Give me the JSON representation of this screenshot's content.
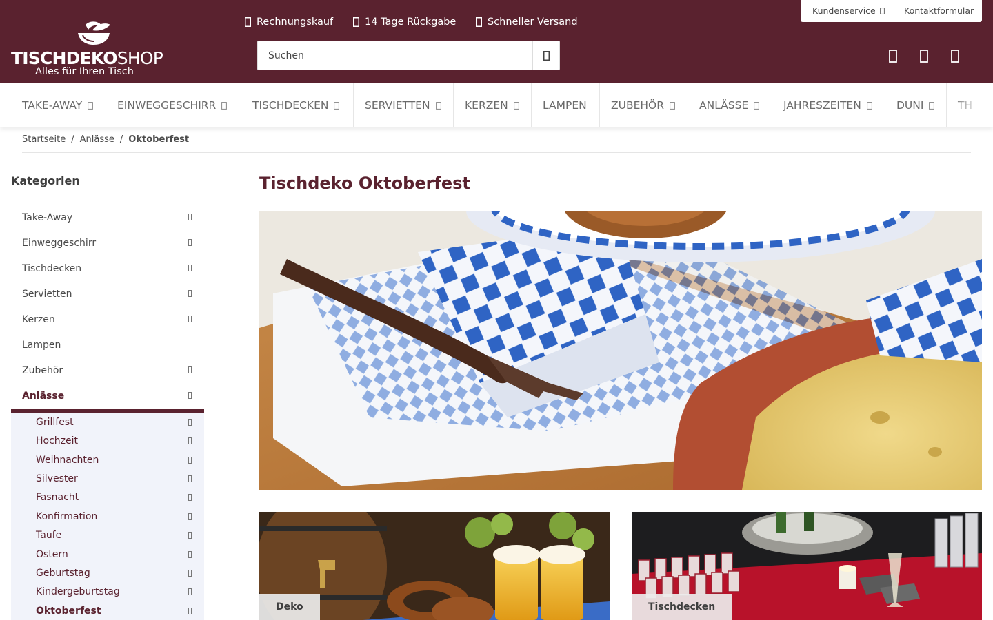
{
  "brand": {
    "name_bold": "TISCHDEKO",
    "name_light": "SHOP",
    "tagline": "Alles für Ihren Tisch",
    "header_color": "#5a222f"
  },
  "usps": [
    {
      "icon": "invoice-icon",
      "label": "Rechnungskauf"
    },
    {
      "icon": "return-icon",
      "label": "14 Tage Rückgabe"
    },
    {
      "icon": "truck-icon",
      "label": "Schneller Versand"
    }
  ],
  "service": {
    "customer_service": "Kundenservice",
    "contact_form": "Kontaktformular"
  },
  "search": {
    "placeholder": "Suchen"
  },
  "header_icons": [
    "heart-icon",
    "user-icon",
    "cart-icon"
  ],
  "nav": [
    {
      "label": "TAKE-AWAY",
      "has_children": true
    },
    {
      "label": "EINWEGGESCHIRR",
      "has_children": true
    },
    {
      "label": "TISCHDECKEN",
      "has_children": true
    },
    {
      "label": "SERVIETTEN",
      "has_children": true
    },
    {
      "label": "KERZEN",
      "has_children": true
    },
    {
      "label": "LAMPEN",
      "has_children": false
    },
    {
      "label": "ZUBEHÖR",
      "has_children": true
    },
    {
      "label": "ANLÄSSE",
      "has_children": true
    },
    {
      "label": "JAHRESZEITEN",
      "has_children": true
    },
    {
      "label": "DUNI",
      "has_children": true
    },
    {
      "label": "TH",
      "has_children": false
    }
  ],
  "breadcrumb": {
    "items": [
      "Startseite",
      "Anlässe",
      "Oktoberfest"
    ],
    "separator": "/"
  },
  "sidebar": {
    "title": "Kategorien",
    "categories": [
      {
        "label": "Take-Away",
        "has_children": true
      },
      {
        "label": "Einweggeschirr",
        "has_children": true
      },
      {
        "label": "Tischdecken",
        "has_children": true
      },
      {
        "label": "Servietten",
        "has_children": true
      },
      {
        "label": "Kerzen",
        "has_children": true
      },
      {
        "label": "Lampen",
        "has_children": false
      },
      {
        "label": "Zubehör",
        "has_children": true
      },
      {
        "label": "Anlässe",
        "has_children": true,
        "active": true
      }
    ],
    "subcategories": [
      {
        "label": "Grillfest"
      },
      {
        "label": "Hochzeit"
      },
      {
        "label": "Weihnachten"
      },
      {
        "label": "Silvester"
      },
      {
        "label": "Fasnacht"
      },
      {
        "label": "Konfirmation"
      },
      {
        "label": "Taufe"
      },
      {
        "label": "Ostern"
      },
      {
        "label": "Geburtstag"
      },
      {
        "label": "Kindergeburtstag"
      },
      {
        "label": "Oktoberfest",
        "current": true
      }
    ]
  },
  "main": {
    "title": "Tischdeko Oktoberfest",
    "tiles": [
      {
        "label": "Deko"
      },
      {
        "label": "Tischdecken"
      }
    ]
  }
}
